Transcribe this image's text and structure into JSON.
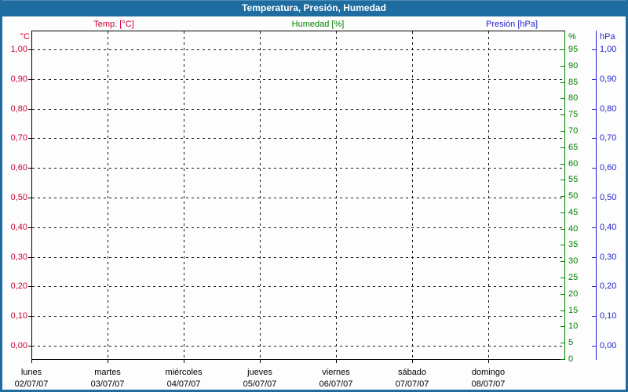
{
  "window": {
    "title": "Temperatura, Presión, Humedad",
    "titlebar_color": "#1f6ca0",
    "border_color": "#1f6ca0"
  },
  "chart_data": {
    "type": "line",
    "title": "Temperatura, Presión, Humedad",
    "legend_position": "top",
    "grid": true,
    "legend": [
      {
        "label": "Temp. [°C]",
        "color": "#cc0033"
      },
      {
        "label": "Humedad [%]",
        "color": "#008000"
      },
      {
        "label": "Presión [hPa]",
        "color": "#2222cc"
      }
    ],
    "axes": {
      "celsius": {
        "title": "°C",
        "color": "#cc0033",
        "side": "left",
        "min": 0.0,
        "max": 1.0,
        "step": 0.1,
        "tick_labels": [
          "1,00",
          "0,90",
          "0,80",
          "0,70",
          "0,60",
          "0,50",
          "0,40",
          "0,30",
          "0,20",
          "0,10",
          "0,00"
        ]
      },
      "humidity": {
        "title": "%",
        "color": "#008000",
        "side": "right",
        "min": 0,
        "max": 95,
        "step": 5,
        "tick_labels": [
          "95",
          "90",
          "85",
          "80",
          "75",
          "70",
          "65",
          "60",
          "55",
          "50",
          "45",
          "40",
          "35",
          "30",
          "25",
          "20",
          "15",
          "10",
          "5",
          "0"
        ]
      },
      "pressure": {
        "title": "hPa",
        "color": "#2222cc",
        "side": "right",
        "min": 0.0,
        "max": 1.0,
        "step": 0.1,
        "tick_labels": [
          "1,00",
          "0,90",
          "0,80",
          "0,70",
          "0,60",
          "0,50",
          "0,40",
          "0,30",
          "0,20",
          "0,10",
          "0,00"
        ]
      }
    },
    "x_axis": {
      "days": [
        {
          "name": "lunes",
          "date": "02/07/07"
        },
        {
          "name": "martes",
          "date": "03/07/07"
        },
        {
          "name": "miércoles",
          "date": "04/07/07"
        },
        {
          "name": "jueves",
          "date": "05/07/07"
        },
        {
          "name": "viernes",
          "date": "06/07/07"
        },
        {
          "name": "sábado",
          "date": "07/07/07"
        },
        {
          "name": "domingo",
          "date": "08/07/07"
        }
      ]
    },
    "series": [
      {
        "name": "Temp. [°C]",
        "axis": "celsius",
        "color": "#cc0033",
        "values": []
      },
      {
        "name": "Humedad [%]",
        "axis": "humidity",
        "color": "#008000",
        "values": []
      },
      {
        "name": "Presión [hPa]",
        "axis": "pressure",
        "color": "#2222cc",
        "values": []
      }
    ]
  }
}
